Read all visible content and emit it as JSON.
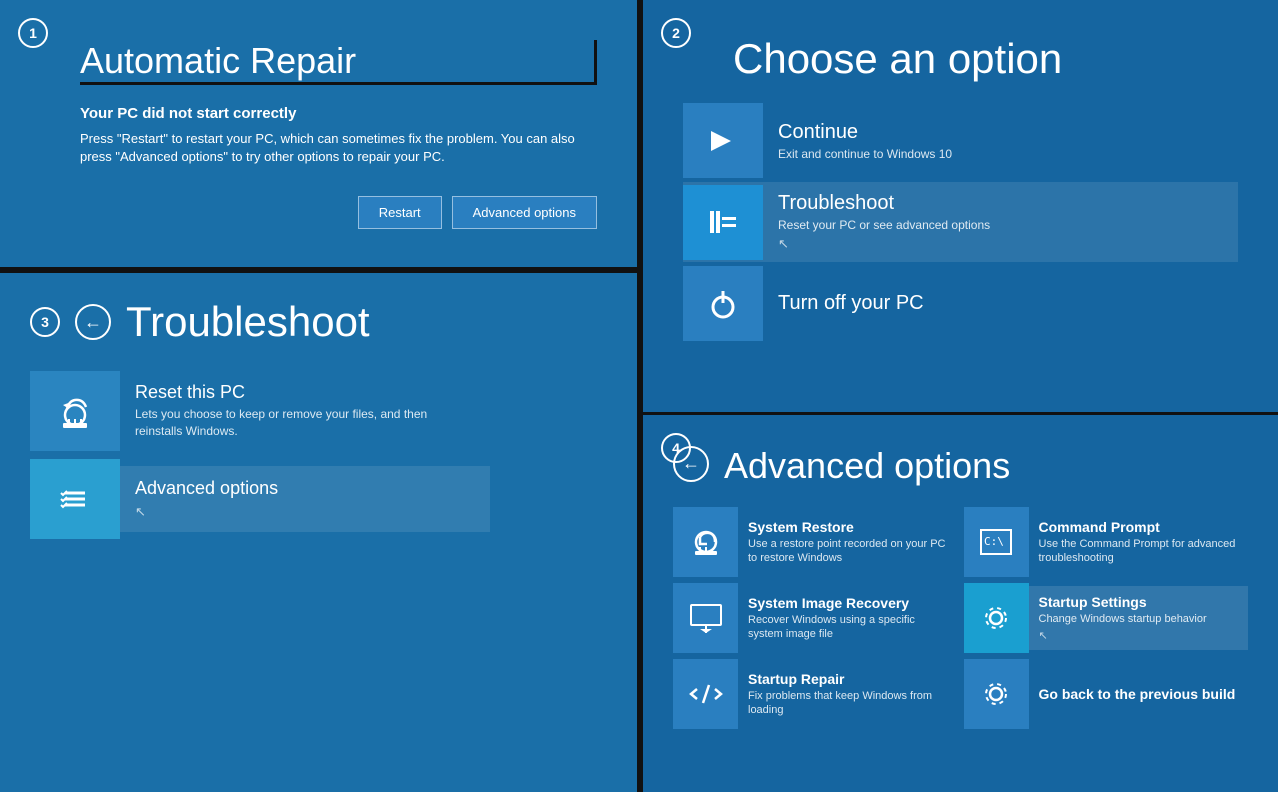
{
  "panel1": {
    "step": "1",
    "title": "Automatic Repair",
    "subtitle": "Your PC did not start correctly",
    "desc": "Press \"Restart\" to restart your PC, which can sometimes fix the problem. You can also press \"Advanced options\" to try other options to repair your PC.",
    "btn_restart": "Restart",
    "btn_advanced": "Advanced options"
  },
  "panel2": {
    "step": "2",
    "title": "Choose an option",
    "options": [
      {
        "name": "Continue",
        "desc": "Exit and continue to Windows 10",
        "icon": "arrow-right"
      },
      {
        "name": "Troubleshoot",
        "desc": "Reset your PC or see advanced options",
        "icon": "wrench",
        "selected": true
      },
      {
        "name": "Turn off your PC",
        "desc": "",
        "icon": "power"
      }
    ]
  },
  "panel3": {
    "step": "3",
    "title": "Troubleshoot",
    "options": [
      {
        "name": "Reset this PC",
        "desc": "Lets you choose to keep or remove your files, and then reinstalls Windows.",
        "icon": "reset"
      },
      {
        "name": "Advanced options",
        "desc": "",
        "icon": "checklist",
        "highlighted": true
      }
    ]
  },
  "panel4": {
    "step": "4",
    "title": "Advanced options",
    "options": [
      {
        "name": "System Restore",
        "desc": "Use a restore point recorded on your PC to restore Windows",
        "icon": "restore"
      },
      {
        "name": "Command Prompt",
        "desc": "Use the Command Prompt for advanced troubleshooting",
        "icon": "cmd"
      },
      {
        "name": "System Image Recovery",
        "desc": "Recover Windows using a specific system image file",
        "icon": "image-recovery"
      },
      {
        "name": "Startup Settings",
        "desc": "Change Windows startup behavior",
        "icon": "settings",
        "highlighted": true
      },
      {
        "name": "Startup Repair",
        "desc": "Fix problems that keep Windows from loading",
        "icon": "code"
      },
      {
        "name": "Go back to the previous build",
        "desc": "",
        "icon": "settings2"
      }
    ]
  }
}
